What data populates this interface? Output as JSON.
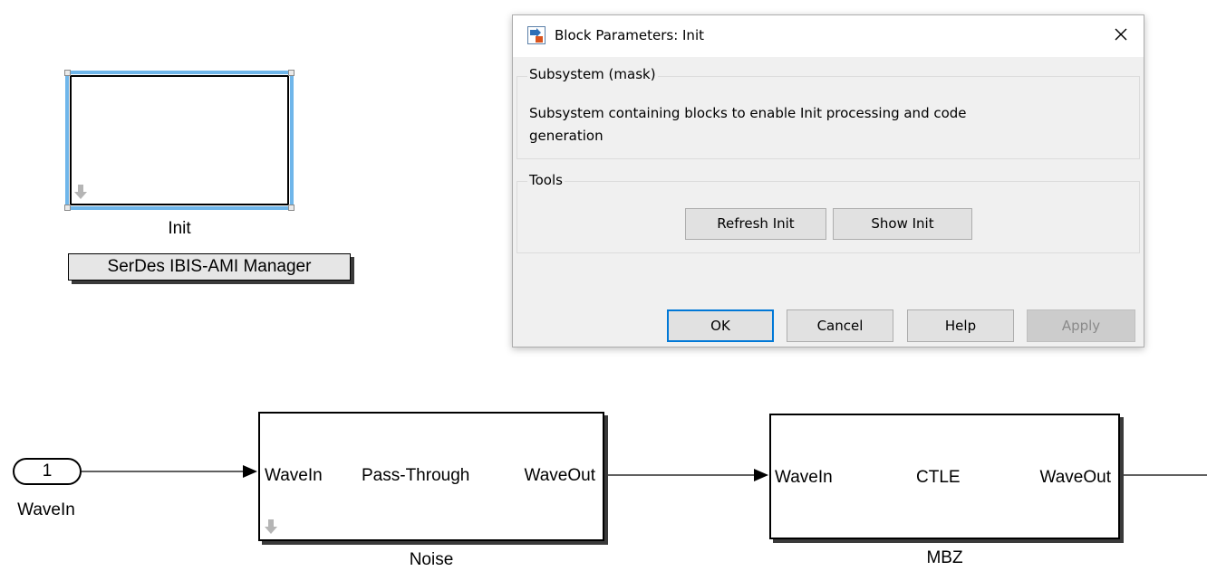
{
  "canvas": {
    "init_block": {
      "label": "Init"
    },
    "ami_manager_button": {
      "label": "SerDes IBIS-AMI Manager"
    },
    "inport": {
      "number": "1",
      "label": "WaveIn"
    },
    "noise_block": {
      "in_port": "WaveIn",
      "title": "Pass-Through",
      "out_port": "WaveOut",
      "label": "Noise"
    },
    "mbz_block": {
      "in_port": "WaveIn",
      "title": "CTLE",
      "out_port": "WaveOut",
      "label": "MBZ"
    }
  },
  "dialog": {
    "title": "Block Parameters: Init",
    "subsystem_group": {
      "legend": "Subsystem (mask)",
      "description_line1": "Subsystem containing blocks to enable Init processing and code",
      "description_line2": "generation"
    },
    "tools_group": {
      "legend": "Tools",
      "refresh_label": "Refresh Init",
      "show_label": "Show Init"
    },
    "buttons": {
      "ok": "OK",
      "cancel": "Cancel",
      "help": "Help",
      "apply": "Apply"
    }
  },
  "colors": {
    "selection_blue": "#6fb6ea",
    "dialog_bg": "#f0f0f0",
    "ok_focus": "#0078d7"
  }
}
